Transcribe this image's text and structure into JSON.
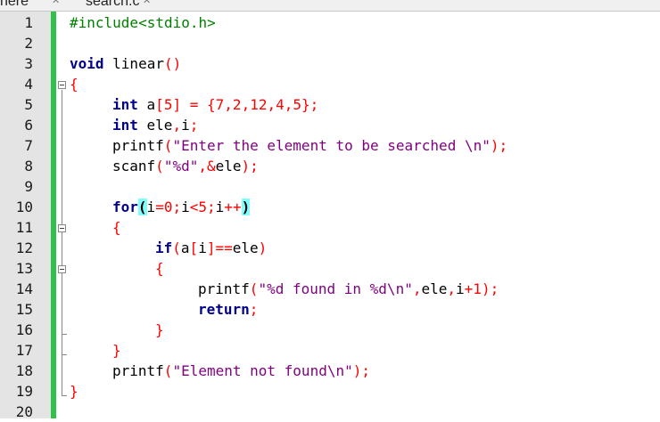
{
  "tabs": [
    {
      "label": "nere",
      "close_icon": "close-icon"
    },
    {
      "label": "searcn.c",
      "close_icon": "close-icon"
    }
  ],
  "editor": {
    "line_numbers": [
      "1",
      "2",
      "3",
      "4",
      "5",
      "6",
      "7",
      "8",
      "9",
      "10",
      "11",
      "12",
      "13",
      "14",
      "15",
      "16",
      "17",
      "18",
      "19",
      "20"
    ],
    "colors": {
      "gutter": "#e4e4e4",
      "change_bar": "#2ec24a",
      "keyword": "#00008b",
      "preprocessor": "#008000",
      "number": "#ff0000",
      "string": "#7f007f",
      "brace_match": "#80ffff"
    },
    "code_lines": {
      "l1": {
        "t1": "#include<stdio.h>"
      },
      "l3": {
        "t1": "void",
        "t2": " linear",
        "t3": "()"
      },
      "l4": {
        "t1": "{"
      },
      "l5": {
        "t1": "int",
        "t2": " a",
        "t3": "[",
        "t4": "5",
        "t5": "]",
        "t6": " = ",
        "t7": "{",
        "t8": "7",
        "t9": ",",
        "t10": "2",
        "t11": ",",
        "t12": "12",
        "t13": ",",
        "t14": "4",
        "t15": ",",
        "t16": "5",
        "t17": "};"
      },
      "l6": {
        "t1": "int",
        "t2": " ele",
        "t3": ",",
        "t4": "i",
        "t5": ";"
      },
      "l7": {
        "t1": "printf",
        "t2": "(",
        "t3": "\"Enter the element to be searched \\n\"",
        "t4": ");"
      },
      "l8": {
        "t1": "scanf",
        "t2": "(",
        "t3": "\"%d\"",
        "t4": ",&",
        "t5": "ele",
        "t6": ");"
      },
      "l10": {
        "t1": "for",
        "t2": "(",
        "t3": "i",
        "t4": "=",
        "t5": "0",
        "t6": ";",
        "t7": "i",
        "t8": "<",
        "t9": "5",
        "t10": ";",
        "t11": "i",
        "t12": "++",
        "t13": ")"
      },
      "l11": {
        "t1": "{"
      },
      "l12": {
        "t1": "if",
        "t2": "(",
        "t3": "a",
        "t4": "[",
        "t5": "i",
        "t6": "]==",
        "t7": "ele",
        "t8": ")"
      },
      "l13": {
        "t1": "{"
      },
      "l14": {
        "t1": "printf",
        "t2": "(",
        "t3": "\"%d found in %d\\n\"",
        "t4": ",",
        "t5": "ele",
        "t6": ",",
        "t7": "i",
        "t8": "+",
        "t9": "1",
        "t10": ");"
      },
      "l15": {
        "t1": "return",
        "t2": ";"
      },
      "l16": {
        "t1": "}"
      },
      "l17": {
        "t1": "}"
      },
      "l18": {
        "t1": "printf",
        "t2": "(",
        "t3": "\"Element not found\\n\"",
        "t4": ");"
      },
      "l19": {
        "t1": "}"
      }
    }
  }
}
